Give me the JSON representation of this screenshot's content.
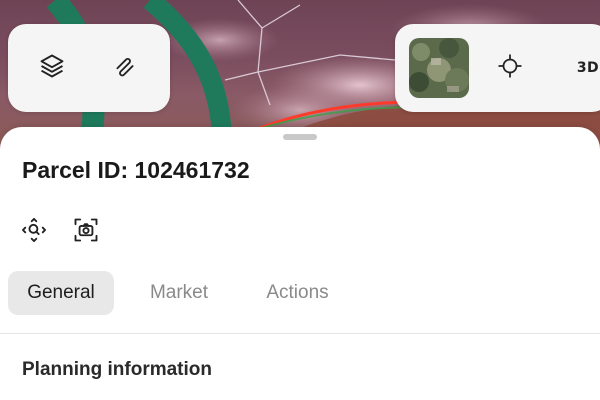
{
  "map": {
    "colors": {
      "base": "#7a4d5e",
      "green_stripe": "#1f7a5c",
      "parcel_outline": "#ff3a2a",
      "lines": "#d9c9d4"
    },
    "layers_button": {
      "icon": "layers-icon"
    },
    "route_button": {
      "icon": "route-icon"
    },
    "basemap_thumbnail": {
      "icon": "satellite-thumbnail"
    },
    "locate_button": {
      "icon": "crosshair-icon"
    },
    "view_3d_label": "3D"
  },
  "sheet": {
    "title": "Parcel ID: 102461732",
    "tools": [
      {
        "icon": "zoom-to-icon"
      },
      {
        "icon": "screenshot-icon"
      }
    ],
    "tabs": [
      {
        "label": "General",
        "active": true
      },
      {
        "label": "Market",
        "active": false
      },
      {
        "label": "Actions",
        "active": false
      }
    ],
    "section_heading": "Planning information"
  }
}
